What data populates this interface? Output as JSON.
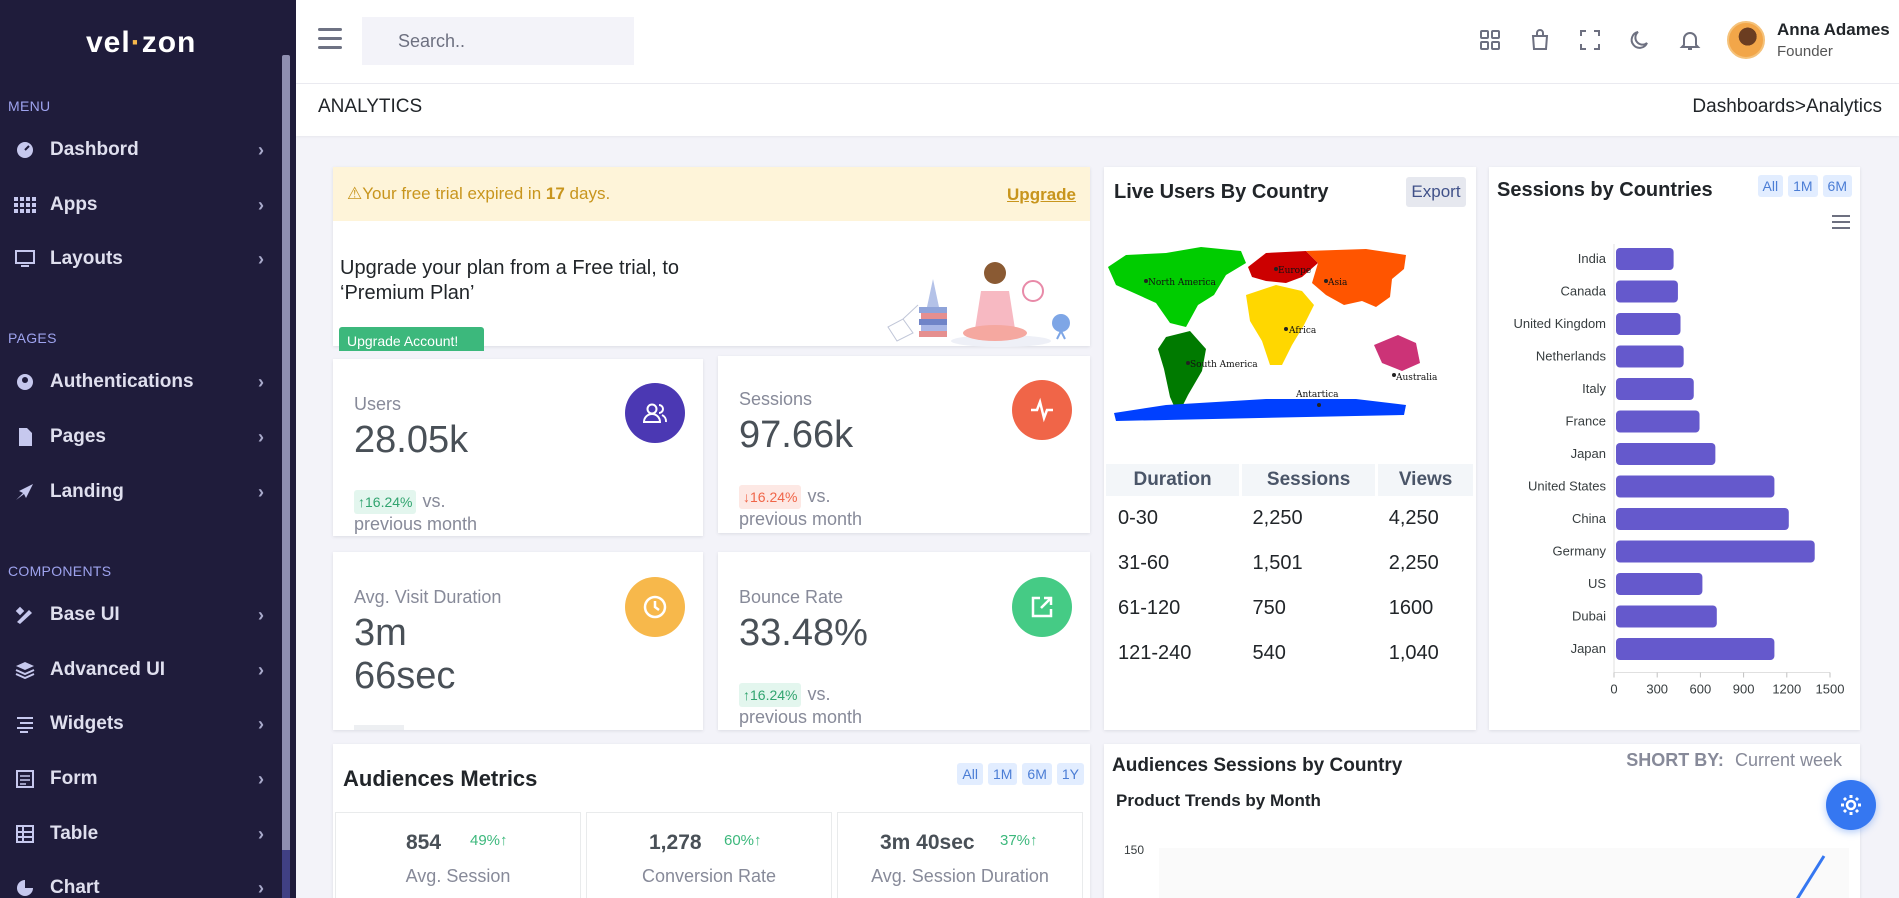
{
  "brand": {
    "name_left": "vel",
    "name_right": "zon"
  },
  "sidebar": {
    "menu_title": "MENU",
    "menu_items": [
      {
        "label": "Dashbord",
        "icon": "dashboard-icon"
      },
      {
        "label": "Apps",
        "icon": "apps-grid-icon"
      },
      {
        "label": "Layouts",
        "icon": "layouts-icon"
      }
    ],
    "pages_title": "PAGES",
    "pages_items": [
      {
        "label": "Authentications",
        "icon": "user-circle-icon"
      },
      {
        "label": "Pages",
        "icon": "pages-icon"
      },
      {
        "label": "Landing",
        "icon": "rocket-icon"
      }
    ],
    "components_title": "COMPONENTS",
    "components_items": [
      {
        "label": "Base UI",
        "icon": "pencil-ruler-icon"
      },
      {
        "label": "Advanced UI",
        "icon": "stack-icon"
      },
      {
        "label": "Widgets",
        "icon": "widgets-icon"
      },
      {
        "label": "Form",
        "icon": "form-icon"
      },
      {
        "label": "Table",
        "icon": "table-icon"
      },
      {
        "label": "Chart",
        "icon": "pie-chart-icon"
      }
    ]
  },
  "topbar": {
    "search_placeholder": "Search..",
    "user_name": "Anna Adames",
    "user_role": "Founder"
  },
  "breadcrumb": {
    "title": "ANALYTICS",
    "path": "Dashboards>Analytics"
  },
  "promo": {
    "alert_prefix": "Your free trial expired in ",
    "alert_days": "17",
    "alert_suffix": " days.",
    "upgrade_link": "Upgrade",
    "message": "Upgrade your plan from a Free trial, to ‘Premium Plan’",
    "button": "Upgrade Account!"
  },
  "stats": {
    "users": {
      "label": "Users",
      "value": "28.05k",
      "change": "16.24%",
      "suffix": "vs.",
      "suffix2": "previous month",
      "color": "#4b38b3"
    },
    "sessions": {
      "label": "Sessions",
      "value": "97.66k",
      "change": "16.24%",
      "suffix": "vs.",
      "suffix2": "previous month",
      "color": "#f06548"
    },
    "avg_visit": {
      "label": "Avg. Visit Duration",
      "value_line1": "3m",
      "value_line2": "66sec",
      "color": "#f7b84b"
    },
    "bounce": {
      "label": "Bounce Rate",
      "value": "33.48%",
      "change": "16.24%",
      "suffix": "vs.",
      "suffix2": "previous month",
      "color": "#45cb85"
    }
  },
  "live_users": {
    "title": "Live Users By Country",
    "export": "Export",
    "map_labels": {
      "na": "North America",
      "sa": "South America",
      "eu": "Europe",
      "as": "Asia",
      "af": "Africa",
      "au": "Australia",
      "an": "Antartica"
    },
    "headers": [
      "Duration",
      "Sessions",
      "Views"
    ],
    "rows": [
      [
        "0-30",
        "2,250",
        "4,250"
      ],
      [
        "31-60",
        "1,501",
        "2,250"
      ],
      [
        "61-120",
        "750",
        "1600"
      ],
      [
        "121-240",
        "540",
        "1,040"
      ]
    ]
  },
  "sessions_countries": {
    "title": "Sessions by Countries",
    "filters": [
      "All",
      "1M",
      "6M"
    ]
  },
  "chart_data": {
    "type": "bar",
    "orientation": "horizontal",
    "categories": [
      "India",
      "Canada",
      "United Kingdom",
      "Netherlands",
      "Italy",
      "France",
      "Japan",
      "United States",
      "China",
      "Germany",
      "US",
      "Dubai",
      "Japan"
    ],
    "values": [
      400,
      430,
      448,
      470,
      540,
      580,
      690,
      1100,
      1200,
      1380,
      600,
      700,
      1100
    ],
    "xlim": [
      0,
      1500
    ],
    "x_ticks": [
      "0",
      "300",
      "600",
      "900",
      "1200",
      "1500"
    ],
    "color": "#6559cc"
  },
  "audiences": {
    "title": "Audiences Metrics",
    "filters": [
      "All",
      "1M",
      "6M",
      "1Y"
    ],
    "metrics": [
      {
        "value": "854",
        "pct": "49%",
        "label": "Avg. Session"
      },
      {
        "value": "1,278",
        "pct": "60%",
        "label": "Conversion Rate"
      },
      {
        "value": "3m 40sec",
        "pct": "37%",
        "label": "Avg. Session Duration"
      }
    ]
  },
  "audience_country": {
    "title": "Audiences Sessions by Country",
    "sort_label": "SHORT BY:",
    "sort_value": "Current week",
    "sub_title": "Product Trends by Month",
    "y_tick": "150"
  }
}
